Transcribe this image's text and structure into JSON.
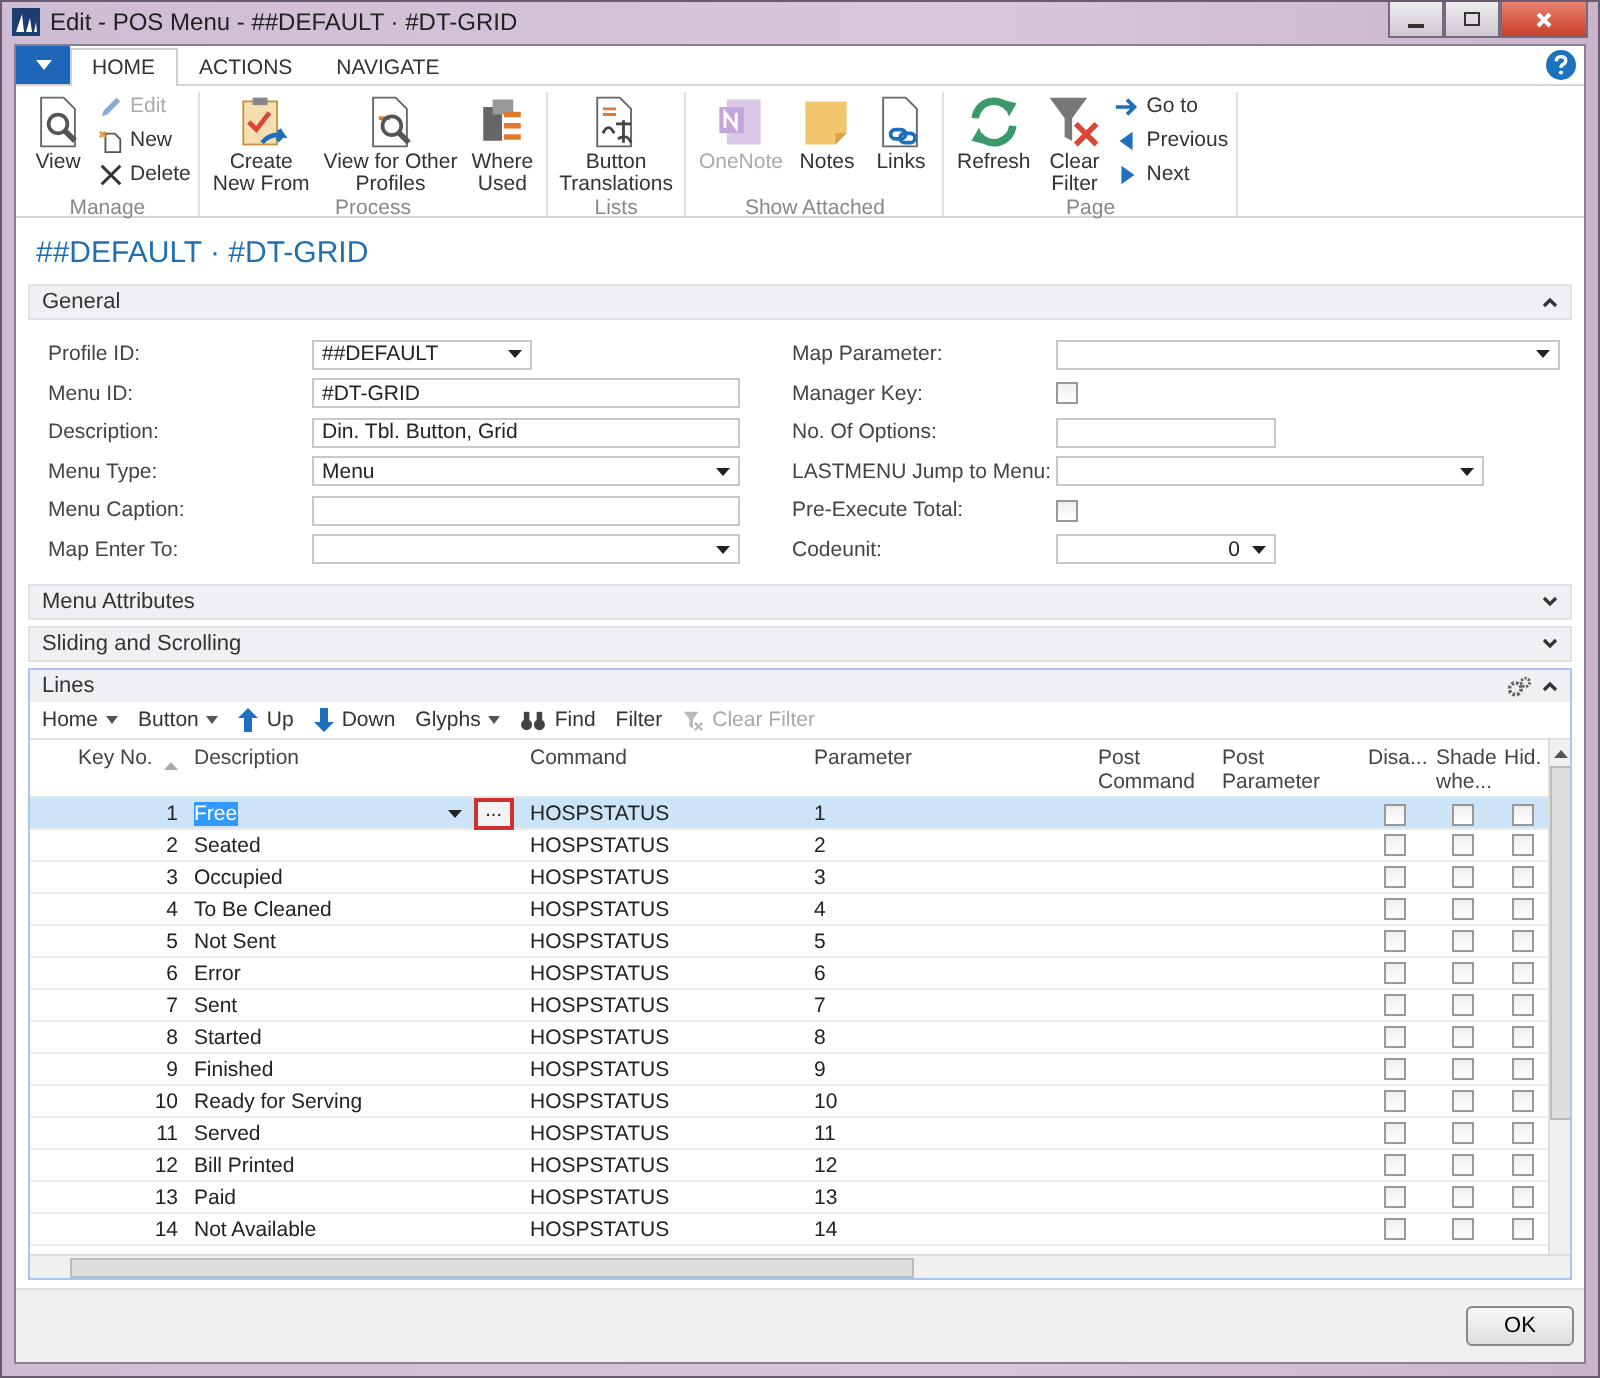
{
  "window": {
    "title": "Edit - POS Menu - ##DEFAULT · #DT-GRID"
  },
  "ribbon": {
    "tabs": [
      {
        "label": "HOME",
        "selected": true
      },
      {
        "label": "ACTIONS",
        "selected": false
      },
      {
        "label": "NAVIGATE",
        "selected": false
      }
    ],
    "groups": [
      {
        "label": "Manage",
        "items": [
          {
            "label": "View",
            "kind": "large",
            "disabled": false
          },
          {
            "label": "Edit",
            "kind": "small",
            "disabled": true
          },
          {
            "label": "New",
            "kind": "small",
            "disabled": false
          },
          {
            "label": "Delete",
            "kind": "small",
            "disabled": false
          }
        ]
      },
      {
        "label": "Process",
        "items": [
          {
            "label": "Create\nNew From",
            "kind": "large",
            "disabled": false
          },
          {
            "label": "View for Other\nProfiles",
            "kind": "large",
            "disabled": false
          },
          {
            "label": "Where\nUsed",
            "kind": "large",
            "disabled": false
          }
        ]
      },
      {
        "label": "Lists",
        "items": [
          {
            "label": "Button\nTranslations",
            "kind": "large",
            "disabled": false
          }
        ]
      },
      {
        "label": "Show Attached",
        "items": [
          {
            "label": "OneNote",
            "kind": "large",
            "disabled": true
          },
          {
            "label": "Notes",
            "kind": "large",
            "disabled": false
          },
          {
            "label": "Links",
            "kind": "large",
            "disabled": false
          }
        ]
      },
      {
        "label": "Page",
        "items": [
          {
            "label": "Refresh",
            "kind": "large",
            "disabled": false
          },
          {
            "label": "Clear\nFilter",
            "kind": "large",
            "disabled": false
          },
          {
            "label": "Go to",
            "kind": "small",
            "disabled": false
          },
          {
            "label": "Previous",
            "kind": "small",
            "disabled": false
          },
          {
            "label": "Next",
            "kind": "small",
            "disabled": false
          }
        ]
      }
    ]
  },
  "page_title": "##DEFAULT · #DT-GRID",
  "general": {
    "title": "General",
    "expanded": true,
    "left": [
      {
        "label": "Profile ID:",
        "kind": "dropdown",
        "value": "##DEFAULT"
      },
      {
        "label": "Menu ID:",
        "kind": "text",
        "value": "#DT-GRID"
      },
      {
        "label": "Description:",
        "kind": "text",
        "value": "Din. Tbl. Button, Grid"
      },
      {
        "label": "Menu Type:",
        "kind": "dropdown",
        "value": "Menu"
      },
      {
        "label": "Menu Caption:",
        "kind": "text"
      },
      {
        "label": "Map Enter To:",
        "kind": "dropdown"
      }
    ],
    "right": [
      {
        "label": "Map Parameter:",
        "kind": "dropdown"
      },
      {
        "label": "Manager Key:",
        "kind": "checkbox",
        "checked": false
      },
      {
        "label": "No. Of Options:",
        "kind": "text"
      },
      {
        "label": "LASTMENU Jump to Menu:",
        "kind": "dropdown"
      },
      {
        "label": "Pre-Execute Total:",
        "kind": "checkbox",
        "checked": false
      },
      {
        "label": "Codeunit:",
        "kind": "number",
        "value": "0"
      }
    ]
  },
  "collapsed_sections": [
    {
      "title": "Menu Attributes",
      "expanded": false
    },
    {
      "title": "Sliding and Scrolling",
      "expanded": false
    }
  ],
  "lines": {
    "title": "Lines",
    "toolbar": [
      {
        "label": "Home",
        "kind": "menu",
        "disabled": false
      },
      {
        "label": "Button",
        "kind": "menu",
        "disabled": false
      },
      {
        "label": "Up",
        "kind": "up",
        "disabled": false
      },
      {
        "label": "Down",
        "kind": "down",
        "disabled": false
      },
      {
        "label": "Glyphs",
        "kind": "menu",
        "disabled": false
      },
      {
        "label": "Find",
        "kind": "find",
        "disabled": false
      },
      {
        "label": "Filter",
        "kind": "plain",
        "disabled": false
      },
      {
        "label": "Clear Filter",
        "kind": "clear",
        "disabled": true
      }
    ],
    "columns": [
      "Key No.",
      "Description",
      "Command",
      "Parameter",
      "Post Command",
      "Post Parameter",
      "Disa...",
      "Shade whe...",
      "Hid."
    ],
    "assist_button": "...",
    "rows": [
      {
        "key": "1",
        "description": "Free",
        "command": "HOSPSTATUS",
        "parameter": "1",
        "checks": [
          false,
          false,
          false
        ],
        "selected": true
      },
      {
        "key": "2",
        "description": "Seated",
        "command": "HOSPSTATUS",
        "parameter": "2",
        "checks": [
          false,
          false,
          false
        ],
        "selected": false
      },
      {
        "key": "3",
        "description": "Occupied",
        "command": "HOSPSTATUS",
        "parameter": "3",
        "checks": [
          false,
          false,
          false
        ],
        "selected": false
      },
      {
        "key": "4",
        "description": "To Be Cleaned",
        "command": "HOSPSTATUS",
        "parameter": "4",
        "checks": [
          false,
          false,
          false
        ],
        "selected": false
      },
      {
        "key": "5",
        "description": "Not Sent",
        "command": "HOSPSTATUS",
        "parameter": "5",
        "checks": [
          false,
          false,
          false
        ],
        "selected": false
      },
      {
        "key": "6",
        "description": "Error",
        "command": "HOSPSTATUS",
        "parameter": "6",
        "checks": [
          false,
          false,
          false
        ],
        "selected": false
      },
      {
        "key": "7",
        "description": "Sent",
        "command": "HOSPSTATUS",
        "parameter": "7",
        "checks": [
          false,
          false,
          false
        ],
        "selected": false
      },
      {
        "key": "8",
        "description": "Started",
        "command": "HOSPSTATUS",
        "parameter": "8",
        "checks": [
          false,
          false,
          false
        ],
        "selected": false
      },
      {
        "key": "9",
        "description": "Finished",
        "command": "HOSPSTATUS",
        "parameter": "9",
        "checks": [
          false,
          false,
          false
        ],
        "selected": false
      },
      {
        "key": "10",
        "description": "Ready for Serving",
        "command": "HOSPSTATUS",
        "parameter": "10",
        "checks": [
          false,
          false,
          false
        ],
        "selected": false
      },
      {
        "key": "11",
        "description": "Served",
        "command": "HOSPSTATUS",
        "parameter": "11",
        "checks": [
          false,
          false,
          false
        ],
        "selected": false
      },
      {
        "key": "12",
        "description": "Bill Printed",
        "command": "HOSPSTATUS",
        "parameter": "12",
        "checks": [
          false,
          false,
          false
        ],
        "selected": false
      },
      {
        "key": "13",
        "description": "Paid",
        "command": "HOSPSTATUS",
        "parameter": "13",
        "checks": [
          false,
          false,
          false
        ],
        "selected": false
      },
      {
        "key": "14",
        "description": "Not Available",
        "command": "HOSPSTATUS",
        "parameter": "14",
        "checks": [
          false,
          false,
          false
        ],
        "selected": false
      }
    ]
  },
  "footer": {
    "ok": "OK"
  }
}
